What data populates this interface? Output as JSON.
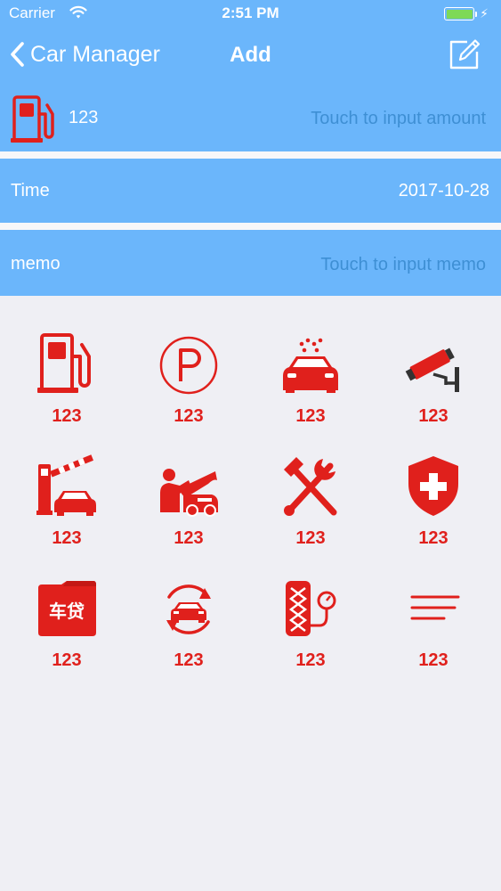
{
  "status_bar": {
    "carrier": "Carrier",
    "time": "2:51 PM",
    "battery_color": "#7ed957"
  },
  "nav": {
    "back_label": "Car Manager",
    "title": "Add",
    "edit_icon": "edit-icon"
  },
  "amount_row": {
    "icon": "fuel-pump-icon",
    "label": "123",
    "placeholder": "Touch to input amount"
  },
  "time_row": {
    "label": "Time",
    "value": "2017-10-28"
  },
  "memo_row": {
    "label": "memo",
    "placeholder": "Touch to input memo"
  },
  "colors": {
    "header_blue": "#6bb6fb",
    "placeholder_blue": "#3e8fd4",
    "accent_red": "#e0201c",
    "background": "#efeff4"
  },
  "categories": [
    {
      "icon": "fuel-pump-icon",
      "label": "123"
    },
    {
      "icon": "parking-icon",
      "label": "123"
    },
    {
      "icon": "car-wash-icon",
      "label": "123"
    },
    {
      "icon": "traffic-camera-icon",
      "label": "123"
    },
    {
      "icon": "toll-gate-icon",
      "label": "123"
    },
    {
      "icon": "car-repair-icon",
      "label": "123"
    },
    {
      "icon": "tools-icon",
      "label": "123"
    },
    {
      "icon": "insurance-shield-icon",
      "label": "123"
    },
    {
      "icon": "car-loan-folder-icon",
      "label": "123",
      "icon_text": "车贷"
    },
    {
      "icon": "car-maintenance-icon",
      "label": "123"
    },
    {
      "icon": "tire-pressure-icon",
      "label": "123"
    },
    {
      "icon": "other-menu-icon",
      "label": "123"
    }
  ]
}
